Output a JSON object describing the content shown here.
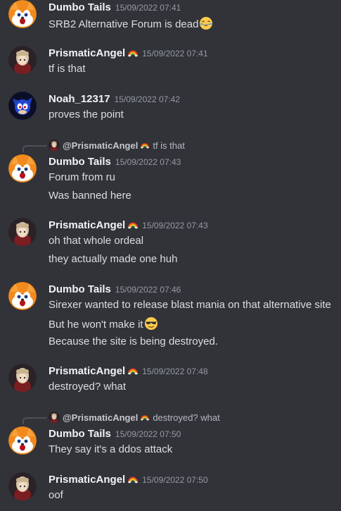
{
  "messages": [
    {
      "author": "Dumbo Tails",
      "timestamp": "15/09/2022 07:41",
      "avatar_icon": "tails-fox-avatar",
      "lines": [
        "SRB2 Alternative Forum is dead"
      ],
      "inline_emoji": "joy-tears-emoji"
    },
    {
      "author": "PrismaticAngel",
      "author_badge_icon": "rainbow-icon",
      "timestamp": "15/09/2022 07:41",
      "avatar_icon": "anime-girl-avatar",
      "lines": [
        "tf is that"
      ]
    },
    {
      "author": "Noah_12317",
      "timestamp": "15/09/2022 07:42",
      "avatar_icon": "sonic-blue-avatar",
      "lines": [
        "proves the point"
      ]
    },
    {
      "reply_to": {
        "author": "@PrismaticAngel",
        "badge_icon": "rainbow-icon",
        "text": "tf is that"
      },
      "author": "Dumbo Tails",
      "timestamp": "15/09/2022 07:43",
      "avatar_icon": "tails-fox-avatar",
      "lines": [
        "Forum from ru",
        "Was banned here"
      ]
    },
    {
      "author": "PrismaticAngel",
      "author_badge_icon": "rainbow-icon",
      "timestamp": "15/09/2022 07:43",
      "avatar_icon": "anime-girl-avatar",
      "lines": [
        "oh that whole ordeal",
        "they actually made one huh"
      ]
    },
    {
      "author": "Dumbo Tails",
      "timestamp": "15/09/2022 07:46",
      "avatar_icon": "tails-fox-avatar",
      "lines": [
        "Sirexer wanted to release blast mania on that alternative site",
        "But he won't make it",
        "Because the site is being destroyed."
      ],
      "inline_emoji": "sunglasses-emoji"
    },
    {
      "author": "PrismaticAngel",
      "author_badge_icon": "rainbow-icon",
      "timestamp": "15/09/2022 07:48",
      "avatar_icon": "anime-girl-avatar",
      "lines": [
        "destroyed? what"
      ]
    },
    {
      "reply_to": {
        "author": "@PrismaticAngel",
        "badge_icon": "rainbow-icon",
        "text": "destroyed? what"
      },
      "author": "Dumbo Tails",
      "timestamp": "15/09/2022 07:50",
      "avatar_icon": "tails-fox-avatar",
      "lines": [
        "They say it's a ddos attack"
      ]
    },
    {
      "author": "PrismaticAngel",
      "author_badge_icon": "rainbow-icon",
      "timestamp": "15/09/2022 07:50",
      "avatar_icon": "anime-girl-avatar",
      "lines": [
        "oof"
      ]
    }
  ],
  "colors": {
    "background": "#313338",
    "username": "#f2f3f5",
    "timestamp": "#949ba4",
    "message_text": "#dbdee1"
  }
}
